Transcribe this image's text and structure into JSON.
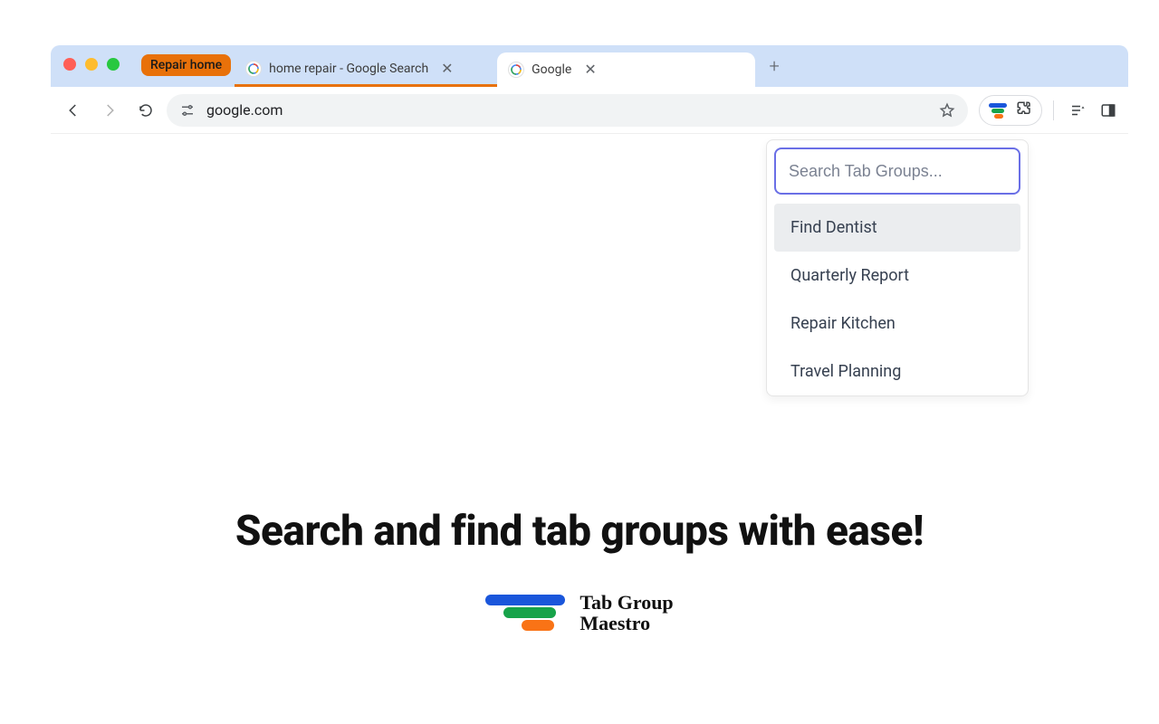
{
  "tabstrip": {
    "group_chip": "Repair home",
    "tabs": [
      {
        "title": "home repair - Google Search",
        "active": false
      },
      {
        "title": "Google",
        "active": true
      }
    ]
  },
  "toolbar": {
    "url": "google.com"
  },
  "popup": {
    "placeholder": "Search Tab Groups...",
    "items": [
      "Find Dentist",
      "Quarterly Report",
      "Repair Kitchen",
      "Travel Planning"
    ],
    "selected_index": 0
  },
  "marketing": {
    "headline": "Search and find tab groups with ease!",
    "brand_line1": "Tab Group",
    "brand_line2": "Maestro"
  }
}
